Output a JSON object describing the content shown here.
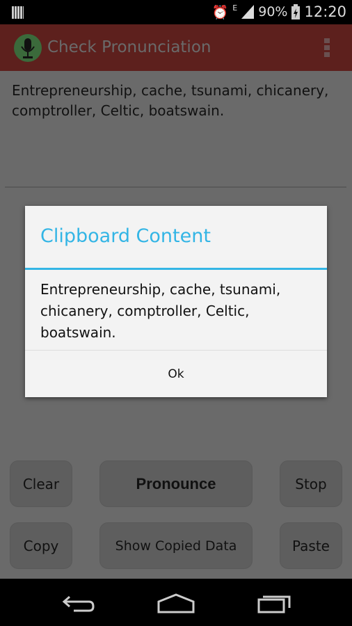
{
  "status_bar": {
    "network": "E",
    "battery": "90%",
    "time": "12:20"
  },
  "app_bar": {
    "title": "Check Pronunciation"
  },
  "editor": {
    "text": "Entrepreneurship, cache, tsunami, chicanery, comptroller, Celtic, boatswain."
  },
  "buttons": {
    "clear": "Clear",
    "pronounce": "Pronounce",
    "stop": "Stop",
    "copy": "Copy",
    "show_copied": "Show Copied Data",
    "paste": "Paste"
  },
  "dialog": {
    "title": "Clipboard Content",
    "message": "Entrepreneurship, cache, tsunami, chicanery, comptroller, Celtic, boatswain.",
    "ok": "Ok"
  },
  "colors": {
    "accent": "#33b5e5",
    "app_bar": "#5d201d"
  }
}
